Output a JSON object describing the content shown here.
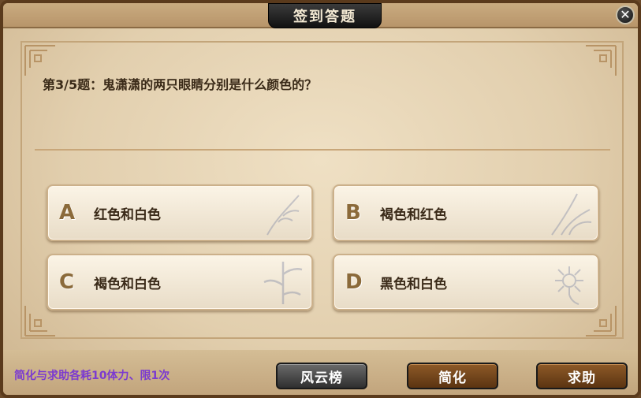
{
  "window": {
    "title": "签到答题",
    "close_icon": "close-icon"
  },
  "question": {
    "text": "第3/5题：鬼潇潇的两只眼睛分别是什么颜色的？"
  },
  "options": [
    {
      "letter": "A",
      "text": "红色和白色"
    },
    {
      "letter": "B",
      "text": "褐色和红色"
    },
    {
      "letter": "C",
      "text": "褐色和白色"
    },
    {
      "letter": "D",
      "text": "黑色和白色"
    }
  ],
  "footer": {
    "note": "简化与求助各耗10体力、限1次",
    "ranking_label": "风云榜",
    "simplify_label": "简化",
    "help_label": "求助"
  },
  "colors": {
    "frame": "#5a3a1c",
    "note": "#7b3ad0",
    "button_brown": "#6d3f17",
    "button_dark": "#3a3a3a"
  }
}
